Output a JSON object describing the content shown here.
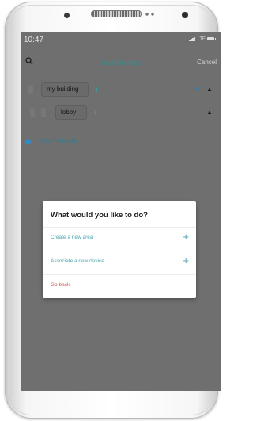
{
  "status": {
    "time": "10:47",
    "network": "LTE"
  },
  "nav": {
    "title": "Your Devices",
    "cancel": "Cancel",
    "search_icon": "search-icon"
  },
  "areas": [
    {
      "name": "my building"
    },
    {
      "name": "lobby"
    }
  ],
  "network": {
    "label": "New Network"
  },
  "dialog": {
    "title": "What would you like to do?",
    "items": [
      {
        "label": "Create a new area"
      },
      {
        "label": "Associate a new device"
      }
    ],
    "back": "Go back"
  },
  "colors": {
    "accent": "#4aa6b0",
    "danger": "#d25b55",
    "overlay": "#6f6f6f"
  }
}
